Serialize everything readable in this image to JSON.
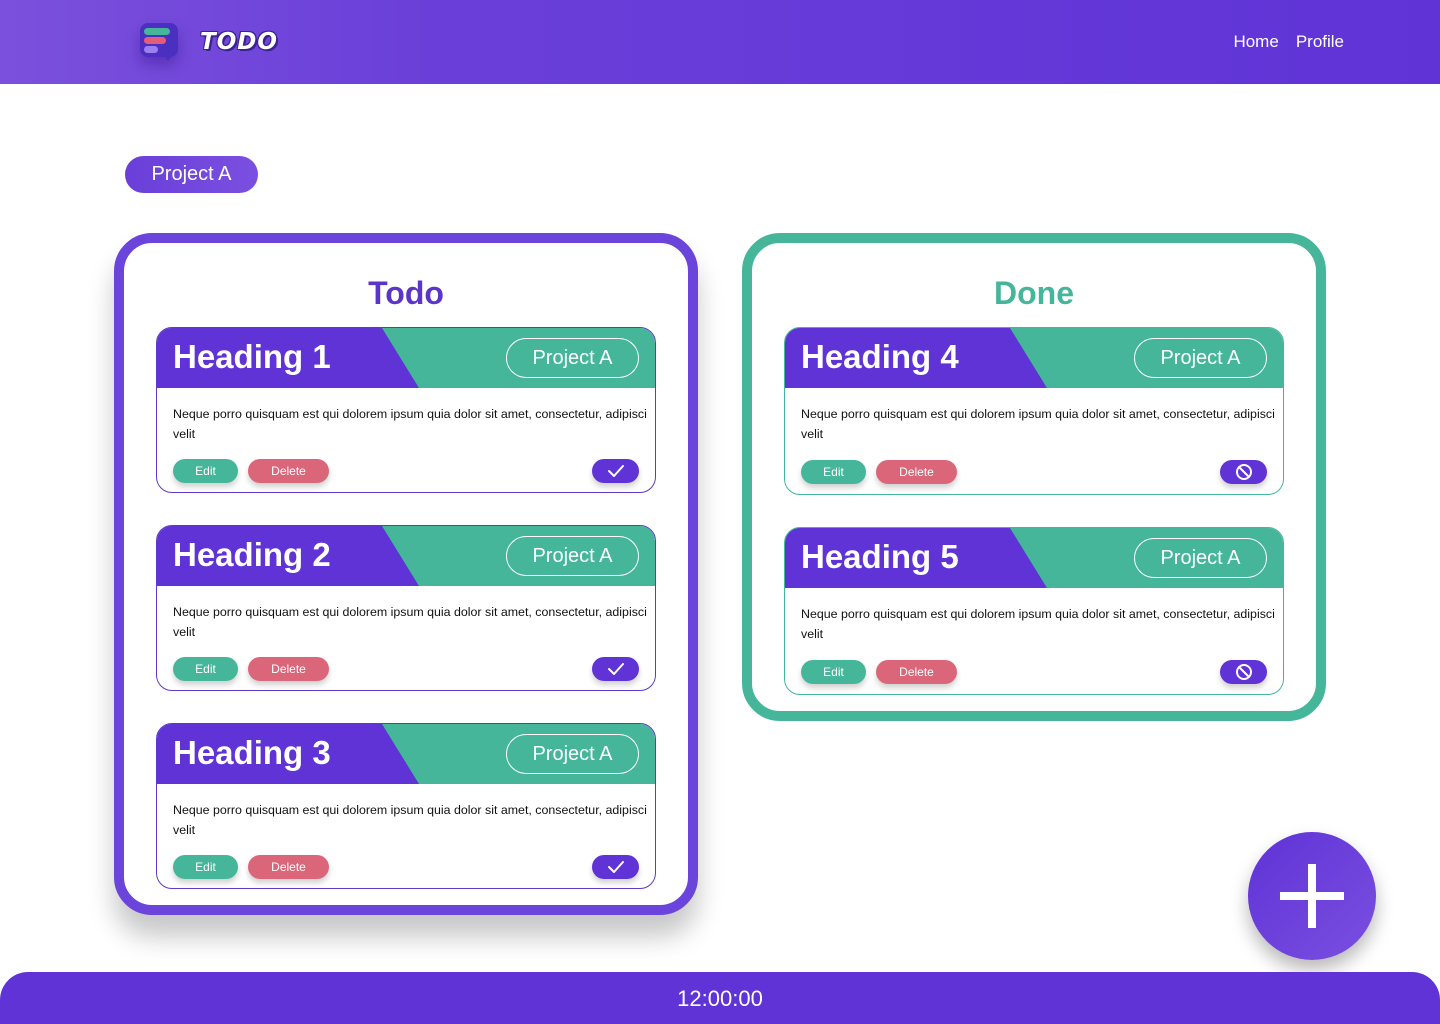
{
  "header": {
    "logo_text": "TODO",
    "nav": [
      "Home",
      "Profile"
    ]
  },
  "project_filter": "Project A",
  "columns": {
    "todo": {
      "title": "Todo",
      "cards": [
        {
          "heading": "Heading 1",
          "tag": "Project A",
          "text": "Neque porro quisquam est qui dolorem ipsum quia dolor sit amet, consectetur, adipisci velit",
          "edit": "Edit",
          "delete": "Delete",
          "action_icon": "check-icon"
        },
        {
          "heading": "Heading 2",
          "tag": "Project A",
          "text": "Neque porro quisquam est qui dolorem ipsum quia dolor sit amet, consectetur, adipisci velit",
          "edit": "Edit",
          "delete": "Delete",
          "action_icon": "check-icon"
        },
        {
          "heading": "Heading 3",
          "tag": "Project A",
          "text": "Neque porro quisquam est qui dolorem ipsum quia dolor sit amet, consectetur, adipisci velit",
          "edit": "Edit",
          "delete": "Delete",
          "action_icon": "check-icon"
        }
      ]
    },
    "done": {
      "title": "Done",
      "cards": [
        {
          "heading": "Heading 4",
          "tag": "Project A",
          "text": "Neque porro quisquam est qui dolorem ipsum quia dolor sit amet, consectetur, adipisci velit",
          "edit": "Edit",
          "delete": "Delete",
          "action_icon": "block-icon"
        },
        {
          "heading": "Heading 5",
          "tag": "Project A",
          "text": "Neque porro quisquam est qui dolorem ipsum quia dolor sit amet, consectetur, adipisci velit",
          "edit": "Edit",
          "delete": "Delete",
          "action_icon": "block-icon"
        }
      ]
    }
  },
  "fab_icon": "plus-icon",
  "footer": {
    "clock": "12:00:00"
  },
  "colors": {
    "primary": "#5f33d6",
    "accent": "#45b69a",
    "danger": "#dc6679"
  }
}
